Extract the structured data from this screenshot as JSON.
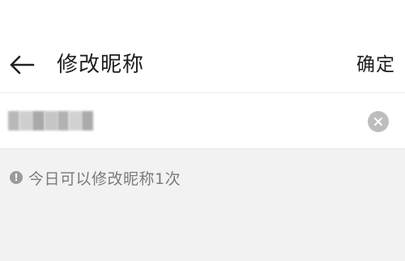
{
  "header": {
    "title": "修改昵称",
    "confirm_label": "确定",
    "back_icon": "arrow-left-icon"
  },
  "nickname_field": {
    "value_obscured": true,
    "clear_icon": "clear-circle-icon"
  },
  "hint": {
    "icon": "info-icon",
    "icon_glyph": "!",
    "text": "今日可以修改昵称1次"
  },
  "colors": {
    "background": "#f2f2f2",
    "surface": "#ffffff",
    "hint_text": "#7a7a7a",
    "clear_button": "#bdbdbd"
  }
}
